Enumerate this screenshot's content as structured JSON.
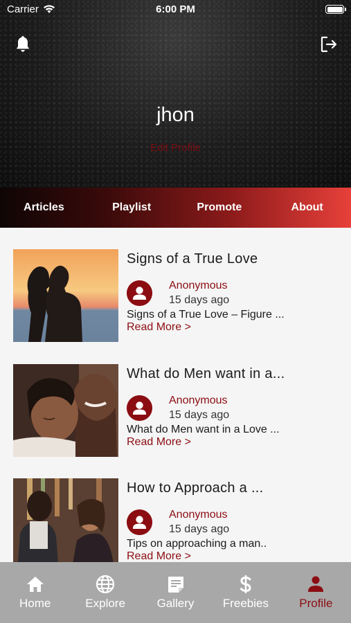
{
  "status_bar": {
    "carrier": "Carrier",
    "time": "6:00 PM"
  },
  "profile": {
    "username": "jhon",
    "edit_label": "Edit Profile"
  },
  "tabs": [
    {
      "label": "Articles"
    },
    {
      "label": "Playlist"
    },
    {
      "label": "Promote"
    },
    {
      "label": "About"
    }
  ],
  "articles": [
    {
      "title": "Signs of a True Love",
      "author": "Anonymous",
      "date": "15 days ago",
      "excerpt": "Signs of a True Love – Figure ...",
      "more": "Read More >"
    },
    {
      "title": "What do Men want in a...",
      "author": "Anonymous",
      "date": "15 days ago",
      "excerpt": "What do Men want in a Love ...",
      "more": "Read More >"
    },
    {
      "title": "How to Approach a ...",
      "author": "Anonymous",
      "date": "15 days ago",
      "excerpt": "Tips on approaching a man..",
      "more": "Read More >"
    }
  ],
  "bottom_nav": [
    {
      "label": "Home",
      "icon": "home-icon"
    },
    {
      "label": "Explore",
      "icon": "globe-icon"
    },
    {
      "label": "Gallery",
      "icon": "gallery-icon"
    },
    {
      "label": "Freebies",
      "icon": "dollar-icon"
    },
    {
      "label": "Profile",
      "icon": "person-icon",
      "active": true
    }
  ],
  "colors": {
    "accent": "#8b0d12",
    "nav_bg": "#a8a8a8",
    "tab_gradient_end": "#e8403a"
  }
}
